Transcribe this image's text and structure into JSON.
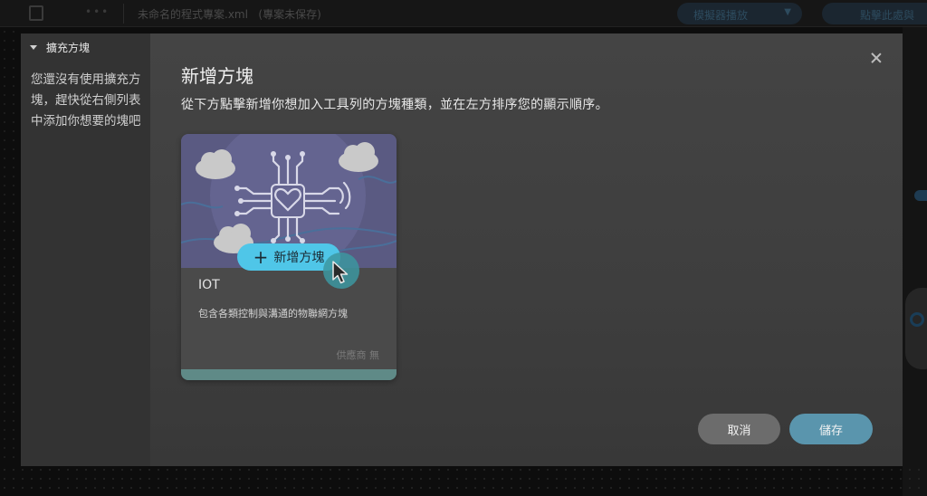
{
  "app": {
    "file_title": "未命名的程式專案.xml",
    "save_status": "(專案未保存)",
    "simulator_label": "模擬器播放",
    "connect_label": "點擊此處與"
  },
  "sidebar": {
    "title": "擴充方塊",
    "hint": "您還沒有使用擴充方塊，趕快從右側列表中添加你想要的塊吧"
  },
  "dialog": {
    "title": "新增方塊",
    "description": "從下方點擊新增你想加入工具列的方塊種類，並在左方排序您的顯示順序。",
    "cards": [
      {
        "name": "IOT",
        "description": "包含各類控制與溝通的物聯網方塊",
        "vendor": "供應商 無",
        "add_label": "新增方塊",
        "icon": "iot-heart-circuit-icon"
      }
    ],
    "cancel_label": "取消",
    "save_label": "儲存"
  },
  "colors": {
    "card_art_bg": "#5a5a82",
    "add_button": "#4fc6e8",
    "save_button": "#5a95ad",
    "cancel_button": "#6c6c6c",
    "card_footer": "#5f8a87"
  }
}
